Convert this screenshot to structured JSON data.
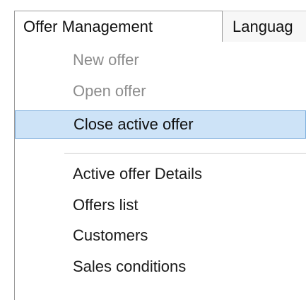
{
  "menubar": {
    "items": [
      {
        "label": "Offer Management"
      },
      {
        "label": "Languag"
      }
    ]
  },
  "dropdown": {
    "items": [
      {
        "label": "New offer",
        "state": "disabled"
      },
      {
        "label": "Open offer",
        "state": "disabled"
      },
      {
        "label": "Close active offer",
        "state": "highlighted"
      },
      {
        "label": "Active offer Details",
        "state": "enabled"
      },
      {
        "label": "Offers list",
        "state": "enabled"
      },
      {
        "label": "Customers",
        "state": "enabled"
      },
      {
        "label": "Sales conditions",
        "state": "enabled"
      }
    ]
  },
  "colors": {
    "highlight_bg": "#cde3f7",
    "highlight_border": "#7fb0de",
    "disabled_text": "#8c8c8c"
  }
}
